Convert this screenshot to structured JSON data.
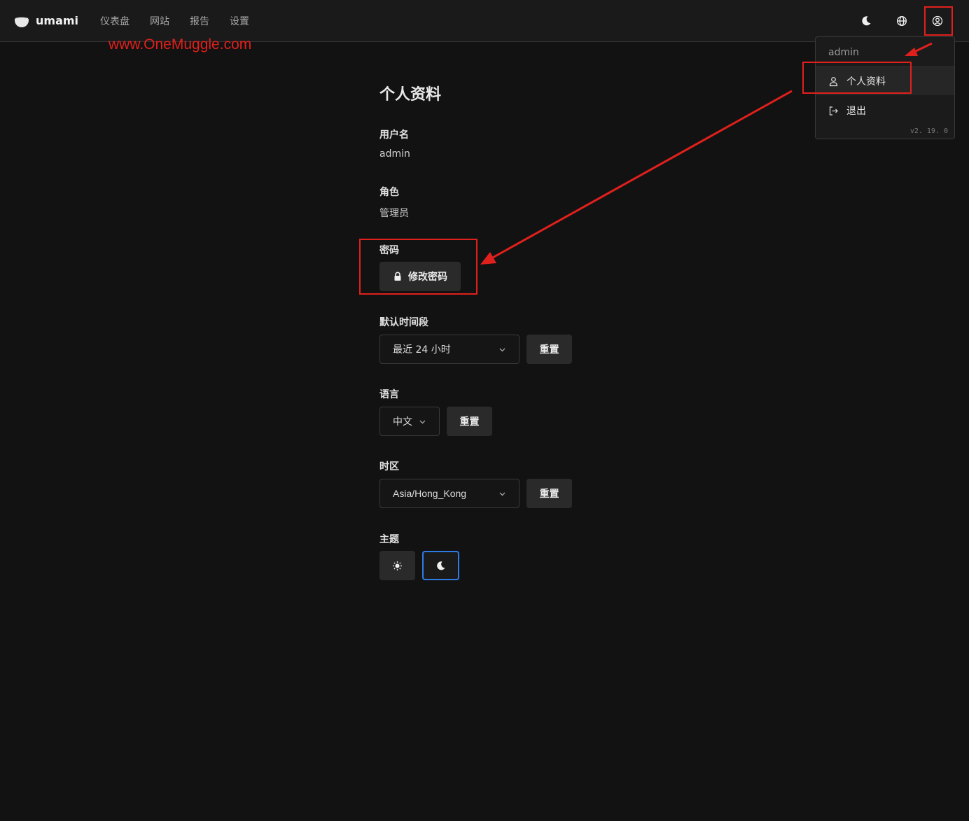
{
  "header": {
    "logo_text": "umami",
    "nav": [
      "仪表盘",
      "网站",
      "报告",
      "设置"
    ]
  },
  "watermark": "www.OneMuggle.com",
  "user_menu": {
    "username": "admin",
    "profile_label": "个人资料",
    "logout_label": "退出",
    "version": "v2. 19. 0"
  },
  "profile": {
    "title": "个人资料",
    "username_label": "用户名",
    "username_value": "admin",
    "role_label": "角色",
    "role_value": "管理员",
    "password_label": "密码",
    "change_password_button": "修改密码",
    "date_range_label": "默认时间段",
    "date_range_value": "最近 24 小时",
    "language_label": "语言",
    "language_value": "中文",
    "timezone_label": "时区",
    "timezone_value": "Asia/Hong_Kong",
    "reset_label": "重置",
    "theme_label": "主题",
    "theme_selected": "dark"
  },
  "colors": {
    "background": "#121212",
    "accent": "#2f7be6",
    "annotation": "#e0201c"
  }
}
